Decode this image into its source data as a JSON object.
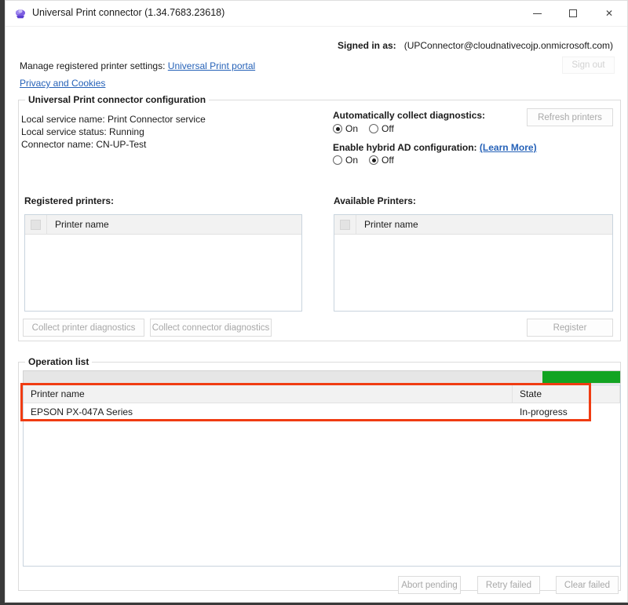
{
  "window": {
    "title": "Universal Print connector (1.34.7683.23618)",
    "icon": "cloud-printer-icon",
    "minimize_label": "Minimize",
    "maximize_label": "Maximize",
    "close_label": "Close"
  },
  "account": {
    "signed_in_label": "Signed in as:",
    "signed_in_value": "(UPConnector@cloudnativecojp.onmicrosoft.com)",
    "sign_out_label": "Sign out"
  },
  "links": {
    "manage_prefix": "Manage registered printer settings:",
    "portal_link": "Universal Print portal",
    "privacy_link": "Privacy and Cookies"
  },
  "config": {
    "legend": "Universal Print connector configuration",
    "local_service_name": "Local service name: Print Connector service",
    "local_service_status": "Local service status: Running",
    "connector_name": "Connector name: CN-UP-Test",
    "diagnostics_title": "Automatically collect diagnostics:",
    "diagnostics_on": "On",
    "diagnostics_off": "Off",
    "diagnostics_value": "On",
    "hybrid_title": "Enable hybrid AD configuration:",
    "hybrid_learn_more": "(Learn More)",
    "hybrid_on": "On",
    "hybrid_off": "Off",
    "hybrid_value": "Off",
    "refresh_printers_label": "Refresh printers"
  },
  "registered": {
    "label": "Registered printers:",
    "column_printer_name": "Printer name",
    "rows": []
  },
  "available": {
    "label": "Available Printers:",
    "column_printer_name": "Printer name",
    "rows": []
  },
  "actions": {
    "collect_printer_diagnostics": "Collect printer diagnostics",
    "collect_connector_diagnostics": "Collect connector diagnostics",
    "register": "Register"
  },
  "operation_list": {
    "legend": "Operation list",
    "progress_percent": 13,
    "progress_color": "#12a422",
    "columns": [
      "Printer name",
      "State"
    ],
    "rows": [
      {
        "printer_name": "EPSON PX-047A Series",
        "state": "In-progress"
      }
    ],
    "highlight_color": "#f03c12",
    "abort_pending_label": "Abort pending",
    "retry_failed_label": "Retry failed",
    "clear_failed_label": "Clear failed"
  }
}
